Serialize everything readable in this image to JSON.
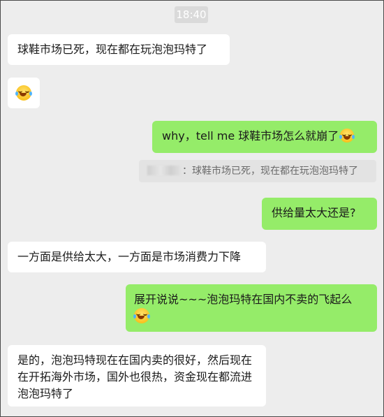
{
  "chat": {
    "timestamp": "18:40",
    "messages": [
      {
        "side": "left",
        "text": "球鞋市场已死，现在都在玩泡泡玛特了"
      },
      {
        "side": "left",
        "emoji": "laughing-crying-emoji"
      },
      {
        "side": "right",
        "text": "why，tell me 球鞋市场怎么就崩了",
        "emoji": "laughing-crying-emoji"
      },
      {
        "side": "quote",
        "text": "：球鞋市场已死，现在都在玩泡泡玛特了"
      },
      {
        "side": "right",
        "text": "供给量太大还是?"
      },
      {
        "side": "left",
        "text": "一方面是供给太大，一方面是市场消费力下降"
      },
      {
        "side": "right",
        "text": "展开说说~~~泡泡玛特在国内不卖的飞起么",
        "emoji": "laughing-crying-emoji"
      },
      {
        "side": "left",
        "text": "是的，泡泡玛特现在在国内卖的很好，然后现在在开拓海外市场，国外也很热，资金现在都流进泡泡玛特了"
      }
    ]
  }
}
